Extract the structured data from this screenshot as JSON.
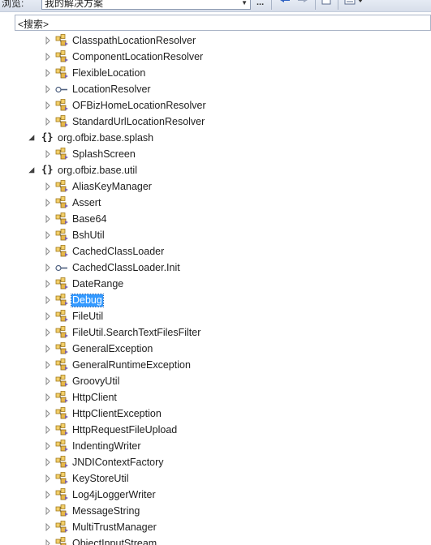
{
  "toolbar": {
    "browse_label": "浏览:",
    "scope_value": "我的解决方案",
    "ellipsis": "..."
  },
  "search": {
    "placeholder": "<搜索>"
  },
  "tree": {
    "items": [
      {
        "label": "ClasspathLocationResolver",
        "kind": "class",
        "level": 2,
        "selected": false
      },
      {
        "label": "ComponentLocationResolver",
        "kind": "class",
        "level": 2,
        "selected": false
      },
      {
        "label": "FlexibleLocation",
        "kind": "class",
        "level": 2,
        "selected": false
      },
      {
        "label": "LocationResolver",
        "kind": "interface",
        "level": 2,
        "selected": false
      },
      {
        "label": "OFBizHomeLocationResolver",
        "kind": "class",
        "level": 2,
        "selected": false
      },
      {
        "label": "StandardUrlLocationResolver",
        "kind": "class",
        "level": 2,
        "selected": false
      },
      {
        "label": "org.ofbiz.base.splash",
        "kind": "namespace",
        "level": 1,
        "selected": false
      },
      {
        "label": "SplashScreen",
        "kind": "class",
        "level": 2,
        "selected": false
      },
      {
        "label": "org.ofbiz.base.util",
        "kind": "namespace",
        "level": 1,
        "selected": false
      },
      {
        "label": "AliasKeyManager",
        "kind": "class",
        "level": 2,
        "selected": false
      },
      {
        "label": "Assert",
        "kind": "class",
        "level": 2,
        "selected": false
      },
      {
        "label": "Base64",
        "kind": "class",
        "level": 2,
        "selected": false
      },
      {
        "label": "BshUtil",
        "kind": "class",
        "level": 2,
        "selected": false
      },
      {
        "label": "CachedClassLoader",
        "kind": "class",
        "level": 2,
        "selected": false
      },
      {
        "label": "CachedClassLoader.Init",
        "kind": "interface",
        "level": 2,
        "selected": false
      },
      {
        "label": "DateRange",
        "kind": "class",
        "level": 2,
        "selected": false
      },
      {
        "label": "Debug",
        "kind": "class",
        "level": 2,
        "selected": true
      },
      {
        "label": "FileUtil",
        "kind": "class",
        "level": 2,
        "selected": false
      },
      {
        "label": "FileUtil.SearchTextFilesFilter",
        "kind": "class",
        "level": 2,
        "selected": false
      },
      {
        "label": "GeneralException",
        "kind": "class",
        "level": 2,
        "selected": false
      },
      {
        "label": "GeneralRuntimeException",
        "kind": "class",
        "level": 2,
        "selected": false
      },
      {
        "label": "GroovyUtil",
        "kind": "class",
        "level": 2,
        "selected": false
      },
      {
        "label": "HttpClient",
        "kind": "class",
        "level": 2,
        "selected": false
      },
      {
        "label": "HttpClientException",
        "kind": "class",
        "level": 2,
        "selected": false
      },
      {
        "label": "HttpRequestFileUpload",
        "kind": "class",
        "level": 2,
        "selected": false
      },
      {
        "label": "IndentingWriter",
        "kind": "class",
        "level": 2,
        "selected": false
      },
      {
        "label": "JNDIContextFactory",
        "kind": "class",
        "level": 2,
        "selected": false
      },
      {
        "label": "KeyStoreUtil",
        "kind": "class",
        "level": 2,
        "selected": false
      },
      {
        "label": "Log4jLoggerWriter",
        "kind": "class",
        "level": 2,
        "selected": false
      },
      {
        "label": "MessageString",
        "kind": "class",
        "level": 2,
        "selected": false
      },
      {
        "label": "MultiTrustManager",
        "kind": "class",
        "level": 2,
        "selected": false
      },
      {
        "label": "ObjectInputStream",
        "kind": "class",
        "level": 2,
        "selected": false
      }
    ]
  }
}
